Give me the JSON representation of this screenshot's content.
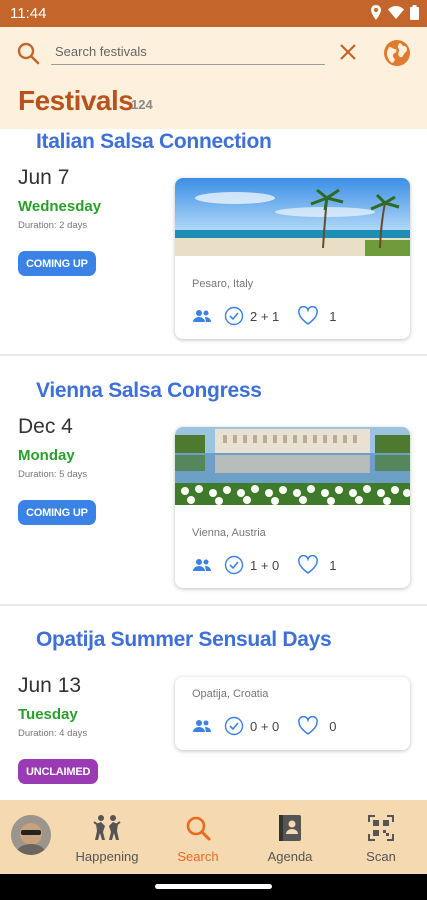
{
  "status": {
    "time": "11:44"
  },
  "search": {
    "placeholder": "Search festivals",
    "value": ""
  },
  "header": {
    "title": "Festivals",
    "count": "124"
  },
  "festivals": [
    {
      "name": "Italian Salsa Connection",
      "date": "Jun 7",
      "weekday": "Wednesday",
      "duration": "Duration: 2 days",
      "status": "COMING UP",
      "location": "Pesaro, Italy",
      "checkins": "2 + 1",
      "likes": "1",
      "image": "beach-palms"
    },
    {
      "name": "Vienna Salsa Congress",
      "date": "Dec 4",
      "weekday": "Monday",
      "duration": "Duration: 5 days",
      "status": "COMING UP",
      "location": "Vienna, Austria",
      "checkins": "1 + 0",
      "likes": "1",
      "image": "palace-reflection"
    },
    {
      "name": "Opatija Summer Sensual Days",
      "date": "Jun 13",
      "weekday": "Tuesday",
      "duration": "Duration: 4 days",
      "status": "UNCLAIMED",
      "location": "Opatija, Croatia",
      "checkins": "0 + 0",
      "likes": "0",
      "image": ""
    }
  ],
  "nav": {
    "items": [
      {
        "label": "Happening",
        "icon": "dancers-icon"
      },
      {
        "label": "Search",
        "icon": "search-icon",
        "active": true
      },
      {
        "label": "Agenda",
        "icon": "agenda-icon"
      },
      {
        "label": "Scan",
        "icon": "qr-scan-icon"
      }
    ]
  },
  "colors": {
    "accent": "#c4662c",
    "title": "#b9531e",
    "festival_name": "#3f6fd8",
    "weekday": "#2aa02a",
    "badge_coming_up": "#3a82e6",
    "badge_unclaimed": "#9b3bb3",
    "nav_active": "#e86a1e"
  }
}
